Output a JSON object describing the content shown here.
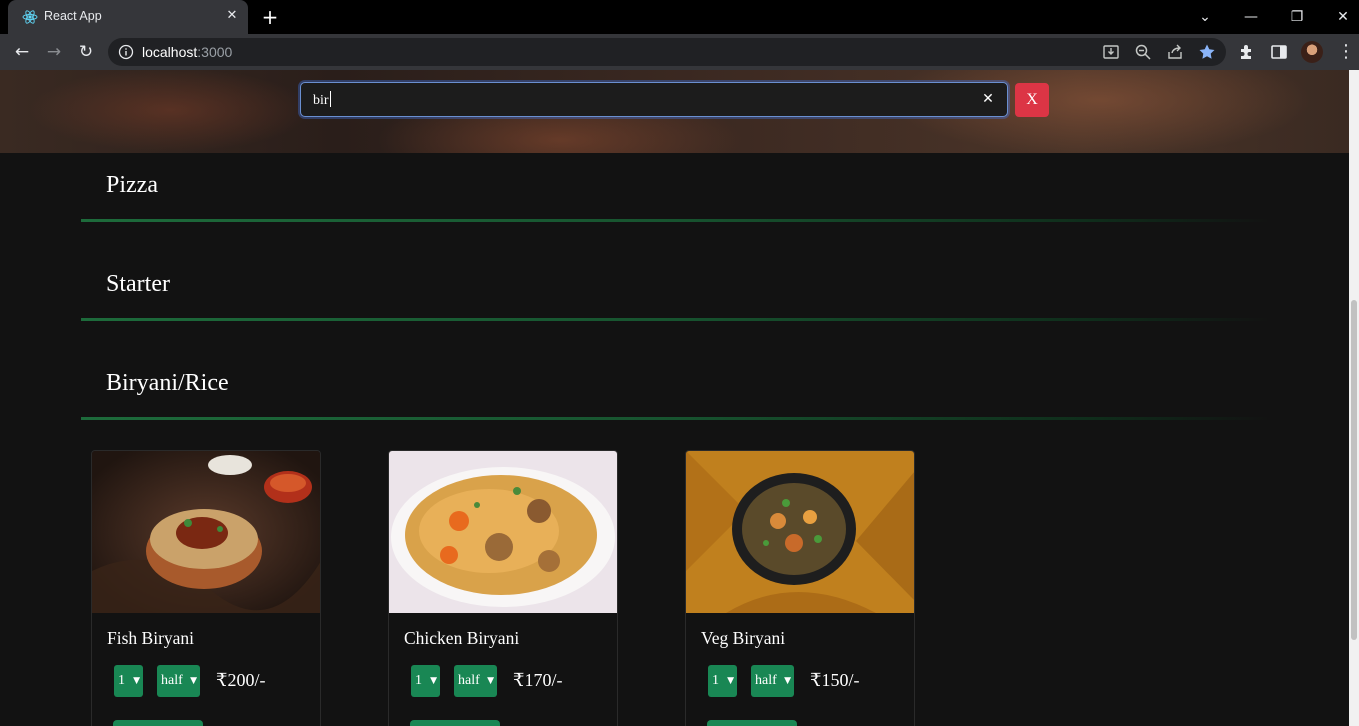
{
  "browser": {
    "tab_title": "React App",
    "url_host": "localhost",
    "url_port": ":3000"
  },
  "search": {
    "value": "bir",
    "cancel_label": "X"
  },
  "categories": [
    {
      "name": "Pizza"
    },
    {
      "name": "Starter"
    },
    {
      "name": "Biryani/Rice"
    }
  ],
  "items": [
    {
      "name": "Fish Biryani",
      "qty": "1",
      "size": "half",
      "price": "₹200/-"
    },
    {
      "name": "Chicken Biryani",
      "qty": "1",
      "size": "half",
      "price": "₹170/-"
    },
    {
      "name": "Veg Biryani",
      "qty": "1",
      "size": "half",
      "price": "₹150/-"
    }
  ],
  "colors": {
    "accent_green": "#198754",
    "danger_red": "#dc3545",
    "background": "#121212"
  }
}
